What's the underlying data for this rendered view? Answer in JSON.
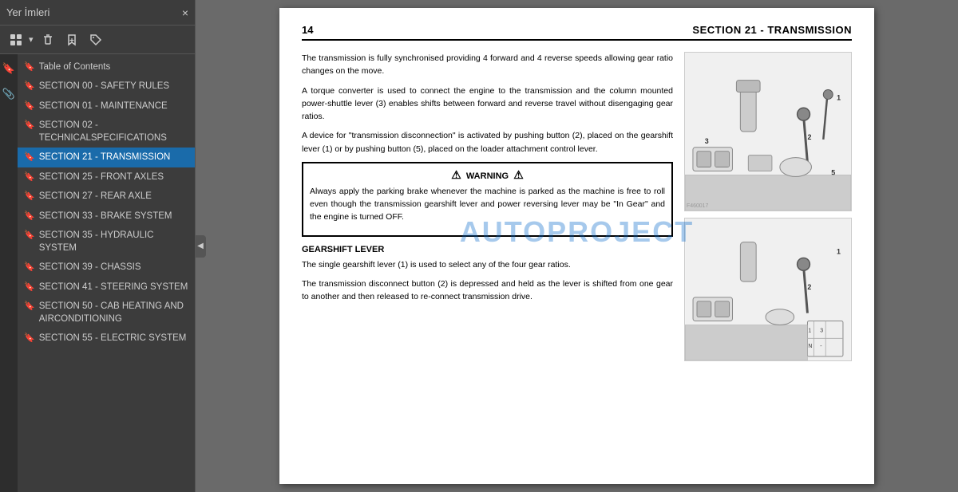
{
  "sidebar": {
    "title": "Yer İmleri",
    "close_label": "×",
    "toolbar": {
      "grid_icon": "⊞",
      "delete_icon": "🗑",
      "bookmark_add_icon": "🔖",
      "tag_icon": "🏷"
    },
    "left_icons": [
      "🔖",
      "📎"
    ],
    "items": [
      {
        "id": "toc",
        "label": "Table of Contents",
        "active": false
      },
      {
        "id": "s00",
        "label": "SECTION 00 - SAFETY RULES",
        "active": false
      },
      {
        "id": "s01",
        "label": "SECTION 01 - MAINTENANCE",
        "active": false
      },
      {
        "id": "s02",
        "label": "SECTION 02 - TECHNICALSPECIFICATIONS",
        "active": false
      },
      {
        "id": "s21",
        "label": "SECTION 21 - TRANSMISSION",
        "active": true
      },
      {
        "id": "s25",
        "label": "SECTION 25 - FRONT AXLES",
        "active": false
      },
      {
        "id": "s27",
        "label": "SECTION 27 - REAR AXLE",
        "active": false
      },
      {
        "id": "s33",
        "label": "SECTION 33 - BRAKE SYSTEM",
        "active": false
      },
      {
        "id": "s35",
        "label": "SECTION 35 - HYDRAULIC SYSTEM",
        "active": false
      },
      {
        "id": "s39",
        "label": "SECTION 39 - CHASSIS",
        "active": false
      },
      {
        "id": "s41",
        "label": "SECTION 41 - STEERING SYSTEM",
        "active": false
      },
      {
        "id": "s50",
        "label": "SECTION 50 - CAB HEATING AND AIRCONDITIONING",
        "active": false
      },
      {
        "id": "s55",
        "label": "SECTION 55 - ELECTRIC SYSTEM",
        "active": false
      }
    ]
  },
  "page": {
    "number": "14",
    "title": "SECTION 21 - TRANSMISSION",
    "paragraphs": [
      "The transmission is fully synchronised providing 4 forward and 4 reverse speeds allowing gear ratio changes on the move.",
      "A torque converter is used to connect the engine to the transmission and the column mounted power-shuttle lever (3) enables shifts between forward and reverse travel without disengaging gear ratios.",
      "A device for \"transmission disconnection\" is activated by pushing button (2), placed on the gearshift lever (1) or by pushing button (5), placed on the loader attachment control lever."
    ],
    "warning_header": "⚠ WARNING ⚠",
    "warning_text": "Always apply the parking brake whenever the machine is parked as the machine is free to roll even though the transmission gearshift lever and power reversing lever may be \"In Gear\" and the engine is turned OFF.",
    "gearshift_heading": "GEARSHIFT LEVER",
    "gearshift_paragraphs": [
      "The single gearshift lever (1) is used to select any of the four gear ratios.",
      "The transmission disconnect button (2) is depressed and held as the lever is shifted from one gear to another and then released to re-connect transmission drive."
    ]
  },
  "watermark": "AUTOPROJECT",
  "collapse_arrow": "◀"
}
